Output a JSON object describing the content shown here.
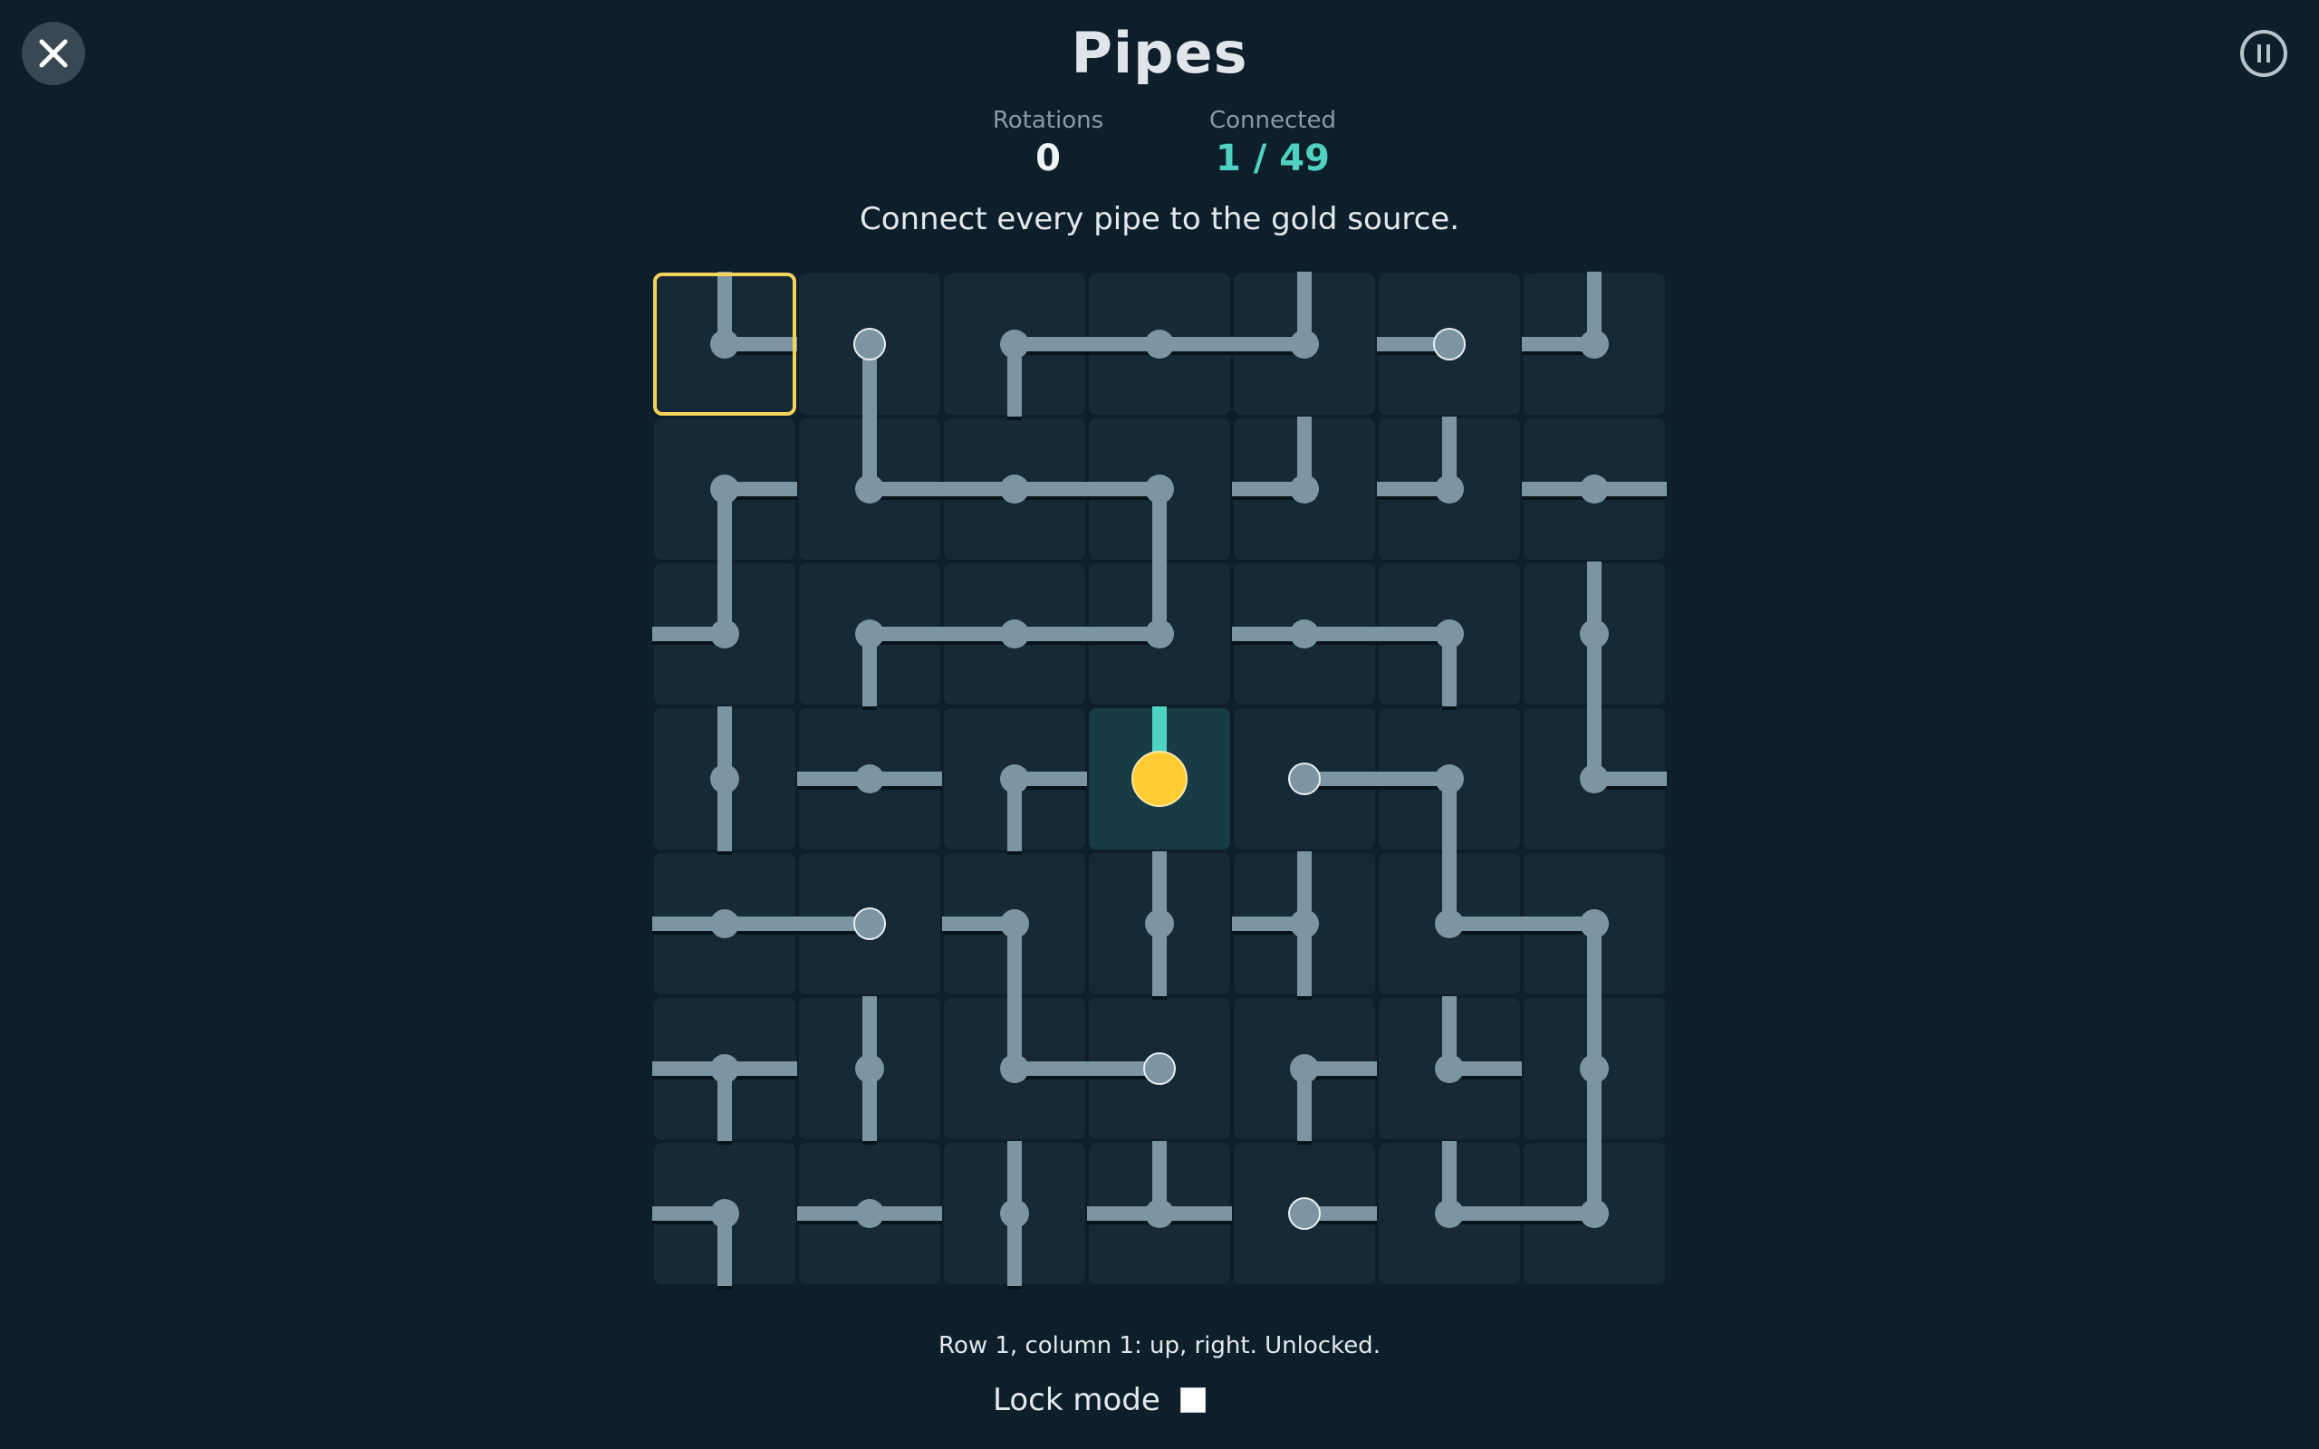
{
  "header": {
    "title": "Pipes",
    "close_icon": "close-icon",
    "pause_icon": "pause-icon"
  },
  "stats": {
    "rotations_label": "Rotations",
    "rotations_value": "0",
    "connected_label": "Connected",
    "connected_value": "1 / 49"
  },
  "instruction": "Connect every pipe to the gold source.",
  "board": {
    "rows": 7,
    "cols": 7,
    "selected": {
      "row": 1,
      "col": 1
    },
    "source": {
      "row": 4,
      "col": 4
    },
    "colors": {
      "tile": "#162a36",
      "pipe": "#7b95a3",
      "pipe_connected": "#4fd2c2",
      "source": "#ffcc33",
      "selection": "#f3d35b",
      "source_tile": "#183b46"
    },
    "cells": [
      [
        "UR",
        "D",
        "RD",
        "LR",
        "LU",
        "L",
        "LU"
      ],
      [
        "RD",
        "UR",
        "LR",
        "LD",
        "LU",
        "LU",
        "LR"
      ],
      [
        "LU",
        "RD",
        "LR",
        "LU",
        "LR",
        "LD",
        "UD"
      ],
      [
        "UD",
        "LR",
        "RD",
        "U",
        "R",
        "LD",
        "UR"
      ],
      [
        "LR",
        "L",
        "LD",
        "UD",
        "LUD",
        "UR",
        "LD"
      ],
      [
        "LRD",
        "UD",
        "UR",
        "L",
        "RD",
        "UR",
        "UD"
      ],
      [
        "LD",
        "LR",
        "UD",
        "LUR",
        "R",
        "UR",
        "LU"
      ]
    ]
  },
  "status_text": "Row 1, column 1: up, right. Unlocked.",
  "lock": {
    "label": "Lock mode",
    "checked": false
  }
}
